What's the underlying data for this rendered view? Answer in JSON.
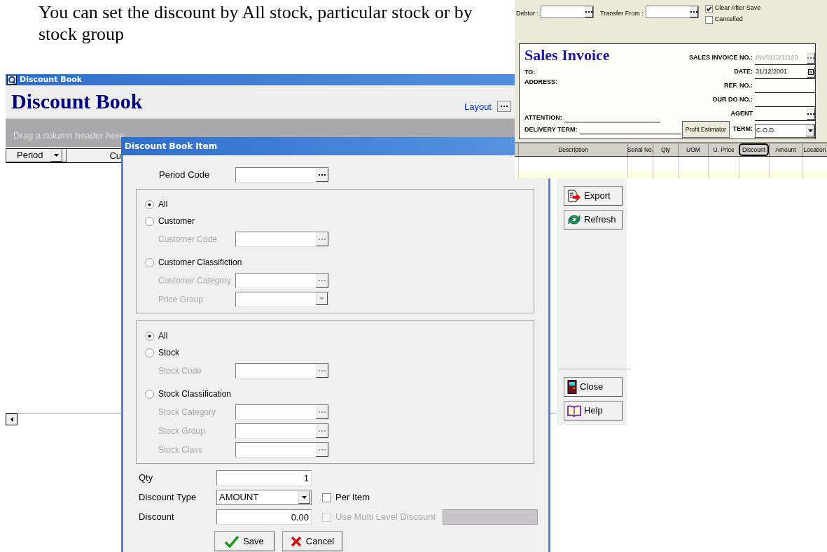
{
  "caption": "You can set the discount by All stock, particular stock or by stock group",
  "main_window": {
    "title": "Discount Book",
    "heading": "Discount Book",
    "layout_link": "Layout",
    "group_panel_hint": "Drag a column header here",
    "columns": [
      {
        "label": "Period",
        "kind": "dropdown"
      },
      {
        "label": "Cu",
        "kind": "plain"
      }
    ],
    "side_buttons": [
      {
        "label": "Export",
        "kind": "export"
      },
      {
        "label": "Refresh",
        "kind": "refresh"
      },
      {
        "label": "Close",
        "kind": "close"
      },
      {
        "label": "Help",
        "kind": "help"
      }
    ]
  },
  "dialog": {
    "title": "Discount Book Item",
    "period_code": {
      "label": "Period Code"
    },
    "customer_filter": [
      {
        "label": "All",
        "selected": true
      },
      {
        "label": "Customer",
        "selected": false,
        "fields": [
          {
            "label": "Customer Code",
            "kind": "lookup",
            "disabled": true
          }
        ]
      },
      {
        "label": "Customer Classifiction",
        "selected": false,
        "fields": [
          {
            "label": "Customer Category",
            "kind": "lookup",
            "disabled": true
          },
          {
            "label": "Price Group",
            "kind": "dropdown",
            "disabled": true
          }
        ]
      }
    ],
    "stock_filter": [
      {
        "label": "All",
        "selected": true
      },
      {
        "label": "Stock",
        "selected": false,
        "fields": [
          {
            "label": "Stock Code",
            "kind": "lookup",
            "disabled": true
          }
        ]
      },
      {
        "label": "Stock Classification",
        "selected": false,
        "fields": [
          {
            "label": "Stock Category",
            "kind": "lookup",
            "disabled": true
          },
          {
            "label": "Stock Group",
            "kind": "lookup",
            "disabled": true
          },
          {
            "label": "Stock Class",
            "kind": "lookup",
            "disabled": true
          }
        ]
      }
    ],
    "qty": {
      "label": "Qty",
      "value": "1"
    },
    "discount_type": {
      "label": "Discount Type",
      "value": "AMOUNT"
    },
    "per_item": {
      "label": "Per Item",
      "checked": false,
      "disabled": false
    },
    "discount": {
      "label": "Discount",
      "value": "0.00"
    },
    "multi_level": {
      "label": "Use Multi Level Discount",
      "checked": false,
      "disabled": true
    },
    "buttons": [
      {
        "label": "Save",
        "kind": "save"
      },
      {
        "label": "Cancel",
        "kind": "cancel"
      }
    ]
  },
  "invoice": {
    "debtor_label": "Debtor :",
    "transfer_label": "Transfer From :",
    "options": [
      {
        "label": "Clear After Save",
        "checked": true
      },
      {
        "label": "Cancelled",
        "checked": false
      }
    ],
    "title": "Sales Invoice",
    "to_label": "TO:",
    "address_label": "ADDRESS:",
    "attention_label": "ATTENTION:",
    "delivery_label": "DELIVERY TERM:",
    "profit_button": "Profit Estimator",
    "fields": [
      {
        "label": "SALES INVOICE NO.:",
        "value": "INV0112/11123",
        "kind": "lookup",
        "disabled": true
      },
      {
        "label": "DATE:",
        "value": "31/12/2001",
        "kind": "date",
        "disabled": false
      },
      {
        "label": "REF. NO.:",
        "kind": "line"
      },
      {
        "label": "OUR DO NO.:",
        "kind": "line"
      },
      {
        "label": "AGENT",
        "kind": "lookup"
      },
      {
        "label": "TERM:",
        "value": "C.O.D.",
        "kind": "dropdown",
        "disabled": false
      }
    ],
    "columns": [
      {
        "label": "Description",
        "highlighted": false
      },
      {
        "label": "Serial No.",
        "highlighted": false
      },
      {
        "label": "Qty",
        "highlighted": false
      },
      {
        "label": "UOM",
        "highlighted": false
      },
      {
        "label": "U. Price",
        "highlighted": false
      },
      {
        "label": "Discount",
        "highlighted": true
      },
      {
        "label": "Amount",
        "highlighted": false
      },
      {
        "label": "Location",
        "highlighted": false
      }
    ]
  }
}
